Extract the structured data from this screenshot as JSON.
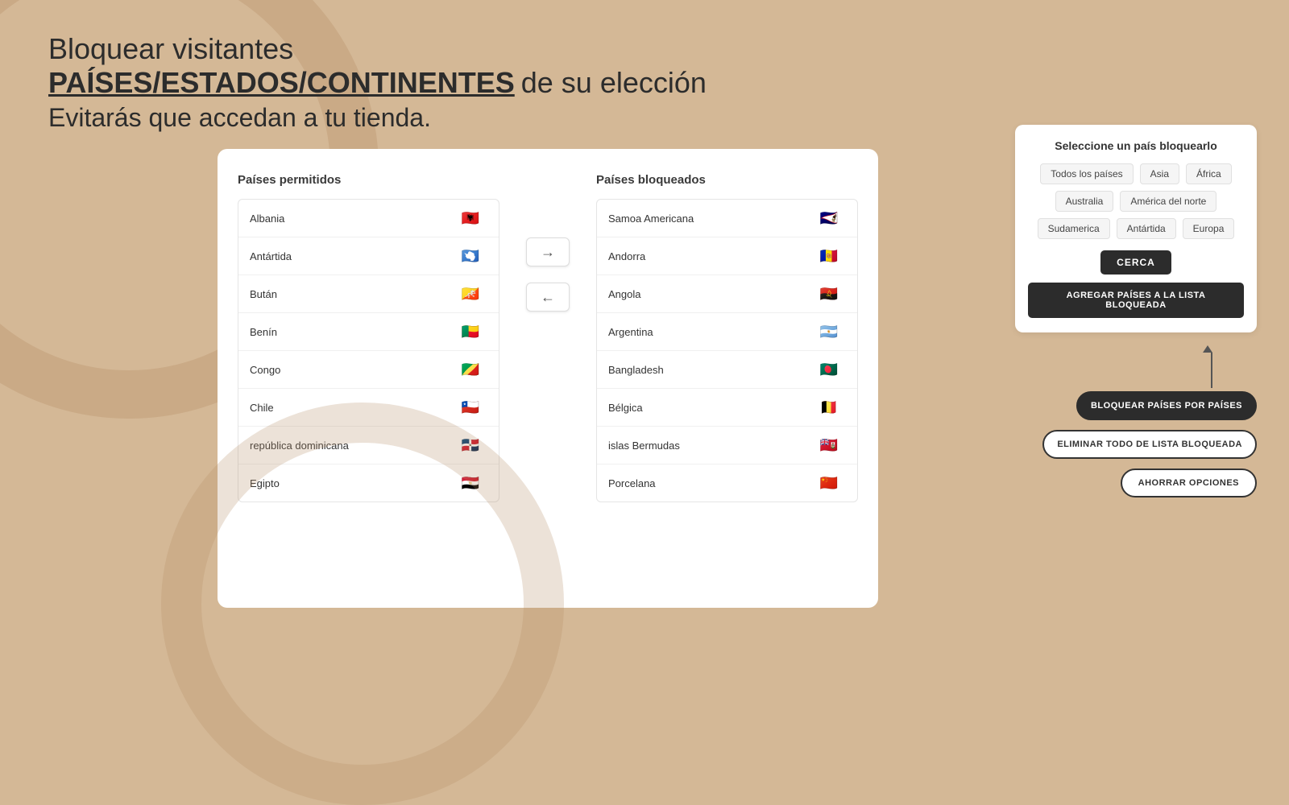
{
  "header": {
    "line1": "Bloquear visitantes",
    "line2": "PAÍSES/ESTADOS/CONTINENTES",
    "line2_suffix": " de su elección",
    "line3": "Evitarás que accedan a tu tienda."
  },
  "allowed_list": {
    "title": "Países permitidos",
    "countries": [
      {
        "name": "Albania",
        "flag_class": "flag-albania",
        "flag_emoji": "🇦🇱"
      },
      {
        "name": "Antártida",
        "flag_class": "flag-antartica",
        "flag_emoji": "🇦🇶"
      },
      {
        "name": "Bután",
        "flag_class": "flag-bhutan",
        "flag_emoji": "🇧🇹"
      },
      {
        "name": "Benín",
        "flag_class": "flag-benin",
        "flag_emoji": "🇧🇯"
      },
      {
        "name": "Congo",
        "flag_class": "flag-congo",
        "flag_emoji": "🇨🇬"
      },
      {
        "name": "Chile",
        "flag_class": "flag-chile",
        "flag_emoji": "🇨🇱"
      },
      {
        "name": "república dominicana",
        "flag_class": "flag-dominican",
        "flag_emoji": "🇩🇴"
      },
      {
        "name": "Egipto",
        "flag_class": "flag-egypt",
        "flag_emoji": "🇪🇬"
      }
    ]
  },
  "blocked_list": {
    "title": "Países bloqueados",
    "countries": [
      {
        "name": "Samoa Americana",
        "flag_class": "flag-samoa",
        "flag_emoji": "🇦🇸"
      },
      {
        "name": "Andorra",
        "flag_class": "flag-andorra",
        "flag_emoji": "🇦🇩"
      },
      {
        "name": "Angola",
        "flag_class": "flag-angola",
        "flag_emoji": "🇦🇴"
      },
      {
        "name": "Argentina",
        "flag_class": "flag-argentina",
        "flag_emoji": "🇦🇷"
      },
      {
        "name": "Bangladesh",
        "flag_class": "flag-bangladesh",
        "flag_emoji": "🇧🇩"
      },
      {
        "name": "Bélgica",
        "flag_class": "flag-belgica",
        "flag_emoji": "🇧🇪"
      },
      {
        "name": "islas Bermudas",
        "flag_class": "flag-bermuda",
        "flag_emoji": "🇧🇲"
      },
      {
        "name": "Porcelana",
        "flag_class": "flag-porcelana",
        "flag_emoji": "🇨🇳"
      }
    ]
  },
  "transfer": {
    "right_arrow": "→",
    "left_arrow": "←"
  },
  "sidebar": {
    "title": "Seleccione un país bloquearlo",
    "continents": [
      "Todos los países",
      "Asia",
      "África",
      "Australia",
      "América del norte",
      "Sudamerica",
      "Antártida",
      "Europa"
    ],
    "search_btn": "CERCA",
    "add_blocked_btn": "AGREGAR PAÍSES A LA LISTA BLOQUEADA"
  },
  "actions": {
    "block_by_country": "BLOQUEAR PAÍSES POR PAÍSES",
    "remove_all": "ELIMINAR TODO DE LISTA BLOQUEADA",
    "save": "AHORRAR OPCIONES"
  }
}
